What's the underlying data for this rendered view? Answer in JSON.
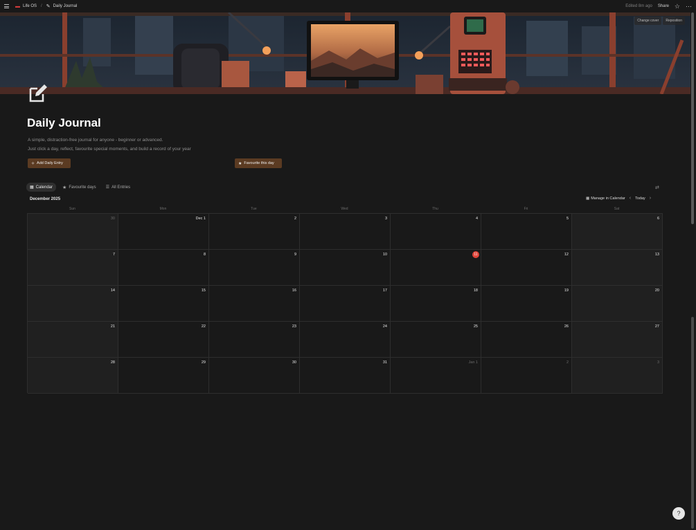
{
  "topbar": {
    "workspace": "Life OS",
    "page": "Daily Journal",
    "edited": "Edited 8m ago",
    "share": "Share"
  },
  "cover": {
    "change_cover": "Change cover",
    "reposition": "Reposition"
  },
  "page": {
    "title": "Daily Journal",
    "description_line1": "A simple, distraction-free journal for anyone - beginner or advanced.",
    "description_line2": "Just click a day, reflect, favourite special moments, and build a record of your year"
  },
  "actions": {
    "add_entry": "Add Daily Entry",
    "favourite_day": "Favourite this day"
  },
  "tabs": [
    {
      "label": "Calendar",
      "icon": "calendar-icon",
      "active": true
    },
    {
      "label": "Favourite days",
      "icon": "star-icon",
      "active": false
    },
    {
      "label": "All Entries",
      "icon": "list-icon",
      "active": false
    }
  ],
  "calendar": {
    "month": "December 2025",
    "manage": "Manage in Calendar",
    "today": "Today",
    "weekdays": [
      "Sun",
      "Mon",
      "Tue",
      "Wed",
      "Thu",
      "Fri",
      "Sat"
    ],
    "weeks": [
      [
        "30",
        "Dec 1",
        "2",
        "3",
        "4",
        "5",
        "6"
      ],
      [
        "7",
        "8",
        "9",
        "10",
        "11",
        "12",
        "13"
      ],
      [
        "14",
        "15",
        "16",
        "17",
        "18",
        "19",
        "20"
      ],
      [
        "21",
        "22",
        "23",
        "24",
        "25",
        "26",
        "27"
      ],
      [
        "28",
        "29",
        "30",
        "31",
        "Jan 1",
        "2",
        "3"
      ]
    ],
    "today_date": "11"
  },
  "colors": {
    "accent_brown": "#5b3b22",
    "today_red": "#e0453a",
    "background": "#191919"
  }
}
